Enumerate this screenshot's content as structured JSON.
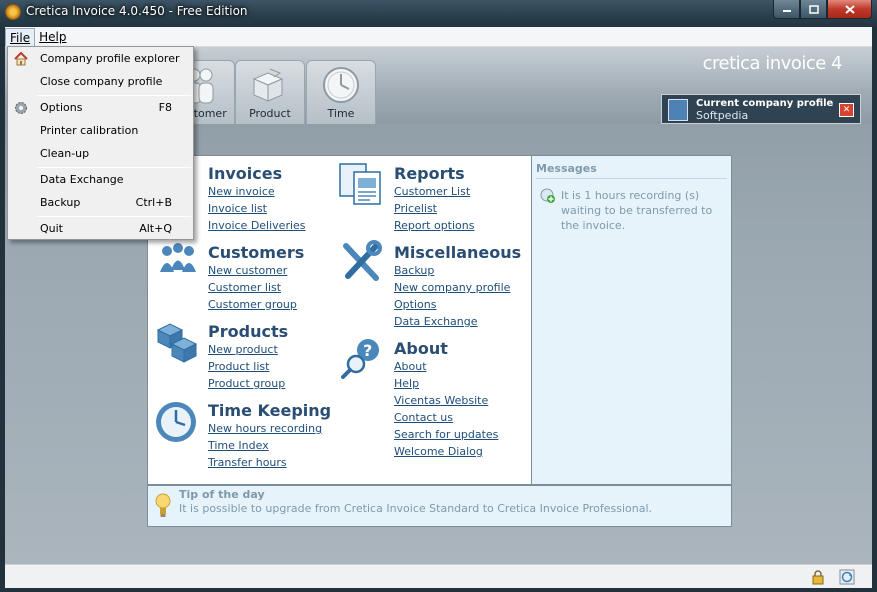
{
  "window": {
    "title": "Cretica Invoice 4.0.450 - Free Edition"
  },
  "menubar": {
    "file": "File",
    "help": "Help"
  },
  "file_menu": {
    "items": [
      {
        "label": "Company profile explorer",
        "shortcut": ""
      },
      {
        "label": "Close company profile",
        "shortcut": ""
      },
      {
        "label": "Options",
        "shortcut": "F8"
      },
      {
        "label": "Printer calibration",
        "shortcut": ""
      },
      {
        "label": "Clean-up",
        "shortcut": ""
      },
      {
        "label": "Data Exchange",
        "shortcut": ""
      },
      {
        "label": "Backup",
        "shortcut": "Ctrl+B"
      },
      {
        "label": "Quit",
        "shortcut": "Alt+Q"
      }
    ]
  },
  "header": {
    "brand": "cretica invoice 4",
    "tabs": [
      "Customer",
      "Product",
      "Time"
    ],
    "company": {
      "title": "Current company profile",
      "name": "Softpedia"
    }
  },
  "sections": {
    "invoices": {
      "title": "Invoices",
      "links": [
        "New invoice",
        "Invoice list",
        "Invoice Deliveries"
      ]
    },
    "customers": {
      "title": "Customers",
      "links": [
        "New customer",
        "Customer list",
        "Customer group"
      ]
    },
    "products": {
      "title": "Products",
      "links": [
        "New product",
        "Product list",
        "Product group"
      ]
    },
    "timekeeping": {
      "title": "Time Keeping",
      "links": [
        "New hours recording",
        "Time Index",
        "Transfer hours"
      ]
    },
    "reports": {
      "title": "Reports",
      "links": [
        "Customer List",
        "Pricelist",
        "Report options"
      ]
    },
    "misc": {
      "title": "Miscellaneous",
      "links": [
        "Backup",
        "New company profile",
        "Options",
        "Data Exchange"
      ]
    },
    "about": {
      "title": "About",
      "links": [
        "About",
        "Help",
        "Vicentas Website",
        "Contact us",
        "Search for updates",
        "Welcome Dialog"
      ]
    }
  },
  "messages": {
    "title": "Messages",
    "text": "It is 1 hours recording (s) waiting to be transferred to the invoice."
  },
  "tip": {
    "title": "Tip of the day",
    "text": "It is possible to upgrade from Cretica Invoice Standard to Cretica Invoice Professional."
  },
  "colors": {
    "accent": "#2a4d73",
    "link": "#1f4e7a",
    "messages_text": "#7f9aab"
  }
}
